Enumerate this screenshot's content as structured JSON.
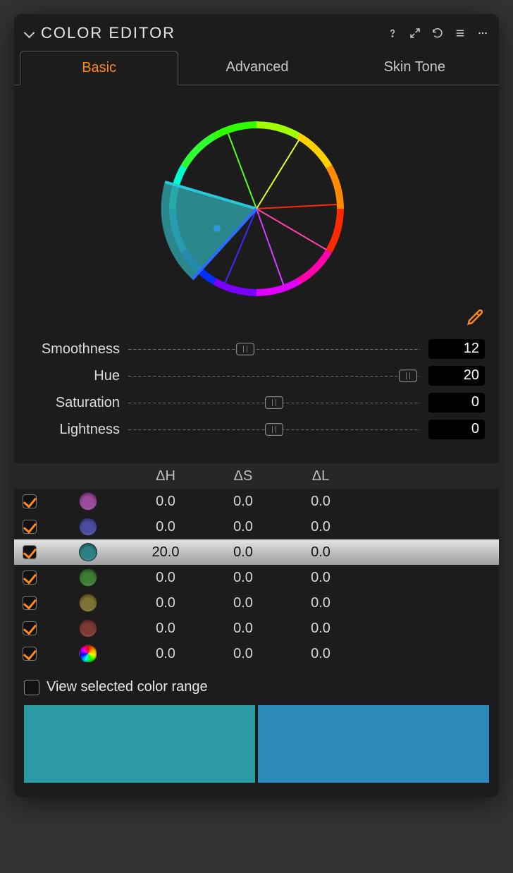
{
  "header": {
    "title": "COLOR EDITOR"
  },
  "tabs": [
    {
      "label": "Basic",
      "active": true
    },
    {
      "label": "Advanced",
      "active": false
    },
    {
      "label": "Skin Tone",
      "active": false
    }
  ],
  "sliders": [
    {
      "label": "Smoothness",
      "value": "12",
      "pos": 40
    },
    {
      "label": "Hue",
      "value": "20",
      "pos": 96
    },
    {
      "label": "Saturation",
      "value": "0",
      "pos": 50
    },
    {
      "label": "Lightness",
      "value": "0",
      "pos": 50
    }
  ],
  "table": {
    "headers": {
      "dh": "ΔH",
      "ds": "ΔS",
      "dl": "ΔL"
    },
    "rows": [
      {
        "checked": true,
        "color": "#9b4b9b",
        "rainbow": false,
        "dh": "0.0",
        "ds": "0.0",
        "dl": "0.0",
        "selected": false
      },
      {
        "checked": true,
        "color": "#4b4b9f",
        "rainbow": false,
        "dh": "0.0",
        "ds": "0.0",
        "dl": "0.0",
        "selected": false
      },
      {
        "checked": true,
        "color": "#2b8185",
        "rainbow": false,
        "dh": "20.0",
        "ds": "0.0",
        "dl": "0.0",
        "selected": true
      },
      {
        "checked": true,
        "color": "#3e7d33",
        "rainbow": false,
        "dh": "0.0",
        "ds": "0.0",
        "dl": "0.0",
        "selected": false
      },
      {
        "checked": true,
        "color": "#7d7333",
        "rainbow": false,
        "dh": "0.0",
        "ds": "0.0",
        "dl": "0.0",
        "selected": false
      },
      {
        "checked": true,
        "color": "#7d3a33",
        "rainbow": false,
        "dh": "0.0",
        "ds": "0.0",
        "dl": "0.0",
        "selected": false
      },
      {
        "checked": true,
        "color": "",
        "rainbow": true,
        "dh": "0.0",
        "ds": "0.0",
        "dl": "0.0",
        "selected": false
      }
    ]
  },
  "viewSelected": {
    "label": "View selected color range",
    "checked": false
  },
  "compare": {
    "before": "#2b9aa3",
    "after": "#2b8ab9"
  }
}
